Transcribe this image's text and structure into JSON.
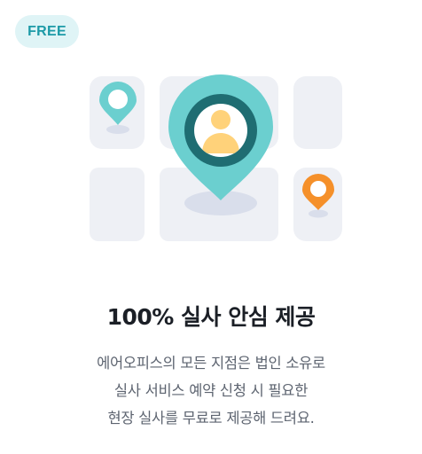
{
  "badge": {
    "label": "FREE"
  },
  "colors": {
    "accent_teal": "#6bcfcf",
    "pin_orange": "#f5902a",
    "avatar_yellow": "#ffd27a",
    "tile_gray": "#eef0f5"
  },
  "icons": {
    "main_pin": "location-pin-person-icon",
    "small_pin_teal": "location-pin-icon",
    "small_pin_orange": "location-pin-icon"
  },
  "content": {
    "title": "100% 실사 안심 제공",
    "description_lines": [
      "에어오피스의 모든 지점은 법인 소유로",
      "실사 서비스 예약 신청 시 필요한",
      "현장 실사를 무료로 제공해 드려요."
    ]
  }
}
